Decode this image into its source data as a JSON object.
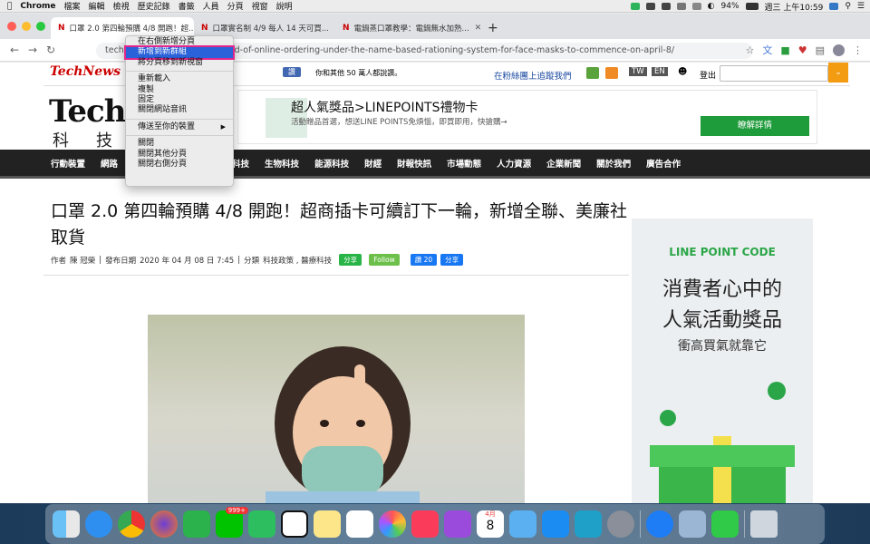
{
  "menubar": {
    "apple": "",
    "app": "Chrome",
    "items": [
      "檔案",
      "編輯",
      "檢視",
      "歷史記錄",
      "書籤",
      "人員",
      "分頁",
      "視窗",
      "說明"
    ],
    "battery": "94%",
    "clock": "週三 上午10:59"
  },
  "tabs": [
    {
      "title": "口罩 2.0 第四輪預購 4/8 開跑！超...",
      "active": true
    },
    {
      "title": "口罩實名制 4/9 每人 14 天可買...",
      "active": false
    },
    {
      "title": "電鍋蒸口罩教學：電鍋無水加熱...",
      "active": false
    }
  ],
  "toolbar": {
    "url": "technews.tw/2020/04/08/round-of-online-ordering-under-the-name-based-rationing-system-for-face-masks-to-commence-on-april-8/"
  },
  "context_menu": {
    "items": [
      {
        "label": "在右側新增分頁",
        "highlight": false
      },
      {
        "label": "新增到新群組",
        "highlight": true
      },
      {
        "label": "將分頁移到新視窗",
        "highlight": false
      },
      {
        "sep": true
      },
      {
        "label": "重新載入",
        "highlight": false
      },
      {
        "label": "複製",
        "highlight": false
      },
      {
        "label": "固定",
        "highlight": false
      },
      {
        "label": "關閉網站音訊",
        "highlight": false
      },
      {
        "sep": true
      },
      {
        "label": "傳送至你的裝置",
        "highlight": false,
        "submenu": "▶"
      },
      {
        "sep": true
      },
      {
        "label": "關閉",
        "highlight": false
      },
      {
        "label": "關閉其他分頁",
        "highlight": false
      },
      {
        "label": "關閉右側分頁",
        "highlight": false
      }
    ]
  },
  "site": {
    "brand_small": "TechNews",
    "logo_big": "TechNews",
    "logo_cn": "科技新報",
    "like_label": "讚",
    "like_text": "你和其他 50 萬人都說讚。",
    "fans": "在粉絲團上追蹤我們",
    "lang_tw": "TW",
    "lang_en": "EN",
    "logout": "登出",
    "search_placeholder": ""
  },
  "ad": {
    "title": "超人氣獎品>LINEPOINTS禮物卡",
    "desc": "活動贈品首選，想送LINE POINTS免煩惱，即買即用，快搶購→",
    "button": "瞭解詳情"
  },
  "nav": [
    "行動裝置",
    "網路",
    "",
    "",
    "尖端科技",
    "生物科技",
    "能源科技",
    "財經",
    "財報快訊",
    "市場動態",
    "人力資源",
    "企業新聞",
    "關於我們",
    "廣告合作"
  ],
  "article": {
    "title": "口罩 2.0 第四輪預購 4/8 開跑！超商插卡可續訂下一輪，新增全聯、美廉社取貨",
    "author_label": "作者",
    "author": "陳 冠榮",
    "date_label": "發布日期",
    "date": "2020 年 04 月 08 日 7:45",
    "category_label": "分類",
    "categories": "科技政策 , 醫療科技",
    "share": "分享",
    "follow": "Follow",
    "like": "讚 20",
    "share2": "分享"
  },
  "side_ad": {
    "brand": "LINE POINT CODE",
    "line1": "消費者心中的",
    "line2": "人氣活動獎品",
    "line3": "衝高買氣就靠它"
  },
  "dock": {
    "apps": [
      "finder-icon",
      "safari-icon",
      "chrome-icon",
      "firefox-icon",
      "feedly-icon",
      "line-icon",
      "evernote-icon",
      "notion-icon",
      "notes-icon",
      "slack-icon",
      "photos-icon",
      "music-icon",
      "podcasts-icon",
      "calendar-icon",
      "preview-icon",
      "appstore-icon",
      "kindle-icon",
      "sysprefs-icon",
      "messenger-icon",
      "iphoto-icon",
      "facetime-icon",
      "trash-icon"
    ],
    "line_badge": "999+",
    "calendar_month": "4月",
    "calendar_day": "8"
  }
}
